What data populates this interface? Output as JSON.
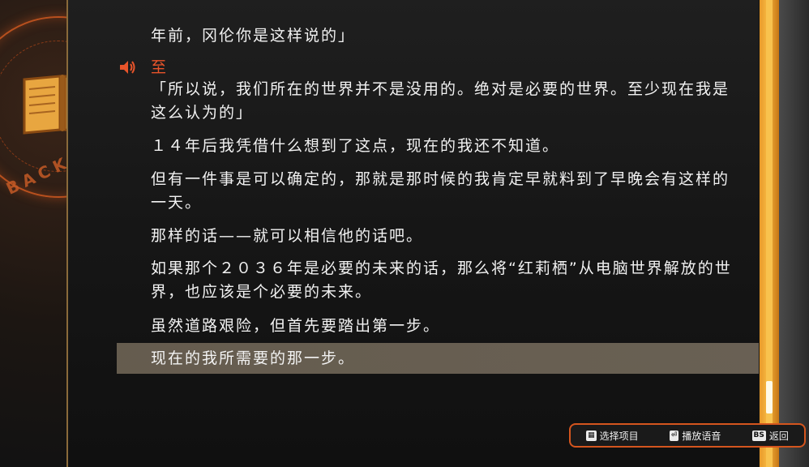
{
  "backlog": {
    "ring_text": "BACKL",
    "speaker": "至",
    "paragraphs": [
      "年前，冈伦你是这样说的」",
      "「所以说，我们所在的世界并不是没用的。绝对是必要的世界。至少现在我是这么认为的」",
      "１４年后我凭借什么想到了这点，现在的我还不知道。",
      "但有一件事是可以确定的，那就是那时候的我肯定早就料到了早晚会有这样的一天。",
      "那样的话——就可以相信他的话吧。",
      "如果那个２０３６年是必要的未来的话，那么将“红莉栖”从电脑世界解放的世界，也应该是个必要的未来。",
      "虽然道路艰险，但首先要踏出第一步。",
      "现在的我所需要的那一步。"
    ]
  },
  "help": {
    "select_key": "▦",
    "select_label": "选择项目",
    "voice_key": "⏎",
    "voice_label": "播放语音",
    "back_key": "BS",
    "back_label": "返回"
  },
  "colors": {
    "speaker": "#e8542a",
    "accent_orange": "#f6b640",
    "frame_red": "#d4551e"
  }
}
